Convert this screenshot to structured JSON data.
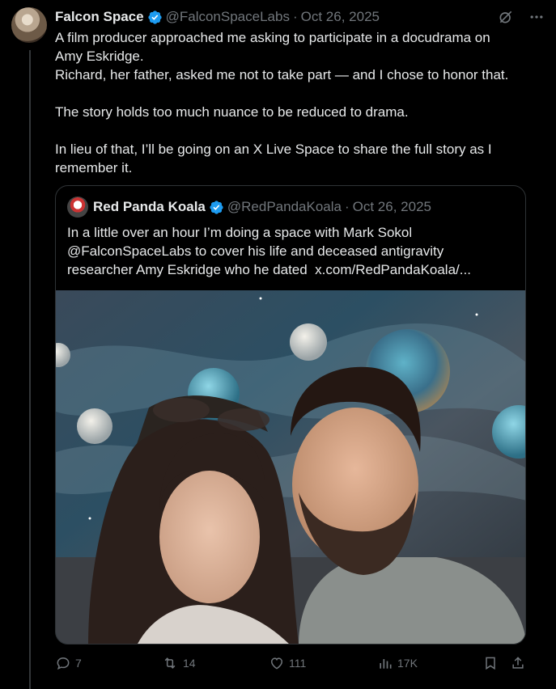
{
  "post": {
    "author_name": "Falcon Space",
    "handle": "@FalconSpaceLabs",
    "separator": "·",
    "date": "Oct 26, 2025",
    "text": "A film producer approached me asking to participate in a docudrama on\nAmy Eskridge.\nRichard, her father, asked me not to take part — and I chose to honor that.\n\nThe story holds too much nuance to be reduced to drama.\n\nIn lieu of that, I’ll be going on an X Live Space to share the full story as I\nremember it."
  },
  "quote": {
    "author_name": "Red Panda Koala",
    "handle": "@RedPandaKoala",
    "separator": "·",
    "date": "Oct 26, 2025",
    "text": "In a little over an hour I’m doing a space with Mark Sokol\n@FalconSpaceLabs to cover his life and deceased antigravity\nresearcher Amy Eskridge who he dated  x.com/RedPandaKoala/..."
  },
  "actions": {
    "replies": "7",
    "reposts": "14",
    "likes": "111",
    "views": "17K"
  },
  "colors": {
    "background": "#000000",
    "text": "#e7e9ea",
    "muted": "#71767b",
    "verified": "#1d9bf0",
    "border": "#2f3336"
  },
  "icons": [
    "grok-icon",
    "more-icon",
    "reply-icon",
    "repost-icon",
    "like-icon",
    "views-icon",
    "bookmark-icon",
    "share-icon",
    "verified-badge-icon"
  ]
}
